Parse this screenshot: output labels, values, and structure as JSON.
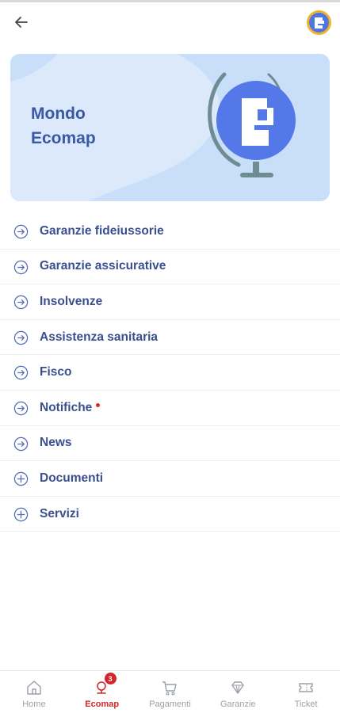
{
  "header": {
    "back_icon": "arrow-left-icon",
    "avatar_icon": "ecomap-logo-icon"
  },
  "banner": {
    "title": "Mondo\nEcomap",
    "illustration": "globe-ecomap-logo"
  },
  "menu": {
    "items": [
      {
        "label": "Garanzie fideiussorie",
        "icon": "arrow-right-circle-icon"
      },
      {
        "label": "Garanzie assicurative",
        "icon": "arrow-right-circle-icon"
      },
      {
        "label": "Insolvenze",
        "icon": "arrow-right-circle-icon"
      },
      {
        "label": "Assistenza sanitaria",
        "icon": "arrow-right-circle-icon"
      },
      {
        "label": "Fisco",
        "icon": "arrow-right-circle-icon"
      },
      {
        "label": "Notifiche",
        "icon": "arrow-right-circle-icon",
        "dot": true
      },
      {
        "label": "News",
        "icon": "arrow-right-circle-icon"
      },
      {
        "label": "Documenti",
        "icon": "plus-circle-icon"
      },
      {
        "label": "Servizi",
        "icon": "plus-circle-icon"
      }
    ]
  },
  "bottom_nav": {
    "items": [
      {
        "label": "Home",
        "icon": "home-icon",
        "active": false
      },
      {
        "label": "Ecomap",
        "icon": "ecomap-pin-icon",
        "active": true,
        "badge": "3"
      },
      {
        "label": "Pagamenti",
        "icon": "cart-icon",
        "active": false
      },
      {
        "label": "Garanzie",
        "icon": "diamond-icon",
        "active": false
      },
      {
        "label": "Ticket",
        "icon": "ticket-icon",
        "active": false
      }
    ]
  },
  "colors": {
    "accent": "#d2262b",
    "primary_text": "#3a4f8f",
    "banner_bg": "#dbe9fb",
    "logo_blue": "#4f74e3"
  }
}
